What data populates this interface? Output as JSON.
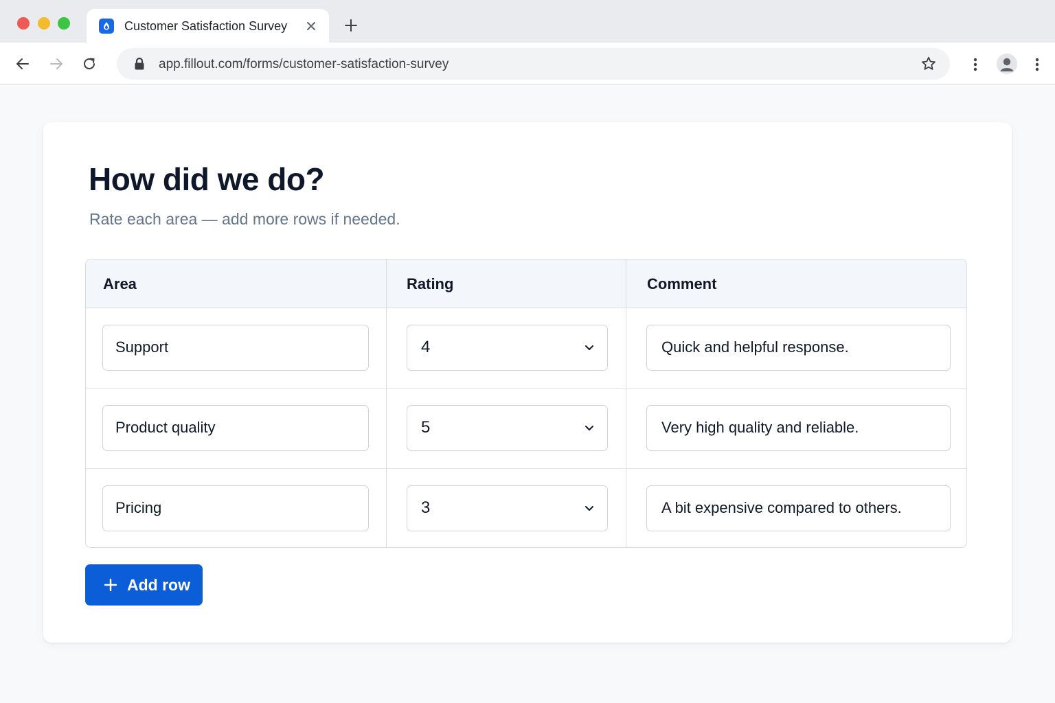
{
  "browser": {
    "tab_title": "Customer Satisfaction Survey",
    "url": "app.fillout.com/forms/customer-satisfaction-survey",
    "icons": {
      "back": "arrow-left-icon",
      "forward": "arrow-right-icon",
      "reload": "reload-icon",
      "lock": "lock-icon",
      "bookmark": "star-icon",
      "extensions": "more-vertical-icon",
      "profile": "account-icon",
      "menu": "more-vertical-icon"
    }
  },
  "form": {
    "title": "How did we do?",
    "subtitle": "Rate each area — add more rows if needed.",
    "columns": [
      "Area",
      "Rating",
      "Comment"
    ],
    "rows": [
      {
        "area": "Support",
        "rating": "4",
        "comment": "Quick and helpful response."
      },
      {
        "area": "Product quality",
        "rating": "5",
        "comment": "Very high quality and reliable."
      },
      {
        "area": "Pricing",
        "rating": "3",
        "comment": "A bit expensive compared to others."
      }
    ],
    "add_row_label": "Add row"
  },
  "colors": {
    "accent": "#0b5ed7",
    "heading": "#0f172a",
    "muted": "#64748b",
    "border": "#d8dde5",
    "header_bg": "#f3f6fb"
  }
}
